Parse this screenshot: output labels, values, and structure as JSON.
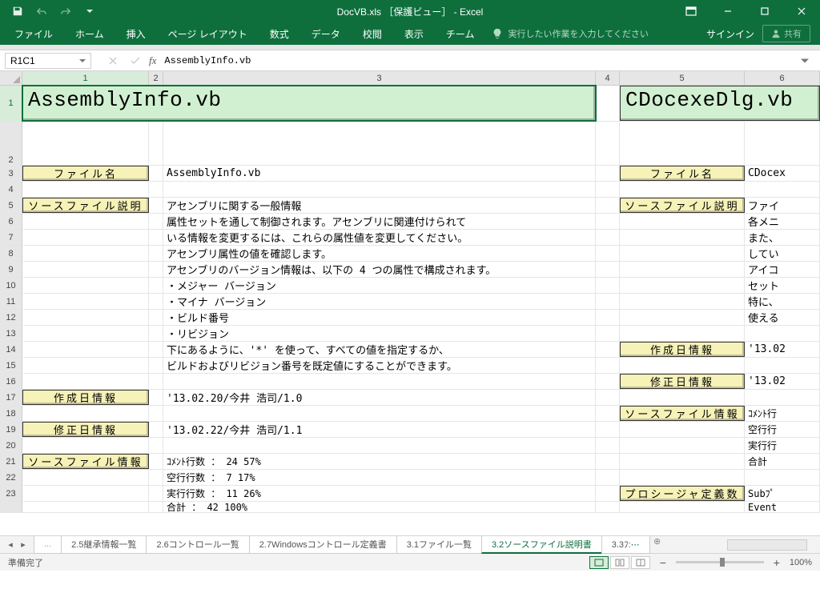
{
  "window": {
    "title": "DocVB.xls ［保護ビュー］ - Excel"
  },
  "ribbon": {
    "tabs": [
      "ファイル",
      "ホーム",
      "挿入",
      "ページ レイアウト",
      "数式",
      "データ",
      "校閲",
      "表示",
      "チーム"
    ],
    "tell_me": "実行したい作業を入力してください",
    "signin": "サインイン",
    "share": "共有"
  },
  "formula": {
    "name_box": "R1C1",
    "value": "AssemblyInfo.vb"
  },
  "columns": [
    "1",
    "2",
    "3",
    "4",
    "5",
    "6"
  ],
  "headers": {
    "left_title": "AssemblyInfo.vb",
    "right_title": "CDocexeDlg.vb"
  },
  "labels": {
    "file_name": "ファイル名",
    "source_desc": "ソースファイル説明",
    "create_info": "作成日情報",
    "update_info": "修正日情報",
    "source_info": "ソースファイル情報",
    "proc_def": "プロシージャ定義数"
  },
  "values": {
    "file_name_val": "AssemblyInfo.vb",
    "desc": [
      "アセンブリに関する一般情報",
      "属性セットを通して制御されます。アセンブリに関連付けられて",
      "いる情報を変更するには、これらの属性値を変更してください。",
      "アセンブリ属性の値を確認します。",
      "アセンブリのバージョン情報は、以下の 4 つの属性で構成されます。",
      "・メジャー バージョン",
      "・マイナ バージョン",
      "・ビルド番号",
      "・リビジョン",
      "下にあるように、'*' を使って、すべての値を指定するか、",
      "ビルドおよびリビジョン番号を既定値にすることができます。"
    ],
    "create_val": "'13.02.20/今井 浩司/1.0",
    "update_val": "'13.02.22/今井 浩司/1.1",
    "src_info": [
      "ｺﾒﾝﾄ行数 ：    24    57%",
      "空行行数 ：     7    17%",
      "実行行数 ：    11    26%",
      "合計     ：    42   100%"
    ],
    "right_col": {
      "file_name_val": "CDocex",
      "desc": [
        "ファイ",
        "各メニ",
        "また、",
        "してい",
        "アイコ",
        "セット",
        "特に、",
        "使える"
      ],
      "create_val": "'13.02",
      "update_val": "'13.02",
      "src_info": [
        "ｺﾒﾝﾄ行",
        "空行行",
        "実行行",
        "合計"
      ],
      "proc": [
        "Subﾌﾟ",
        "Event"
      ]
    }
  },
  "sheets": {
    "overflow": "...",
    "tabs": [
      "2.5継承情報一覧",
      "2.6コントロール一覧",
      "2.7Windowsコントロール定義書",
      "3.1ファイル一覧",
      "3.2ソースファイル説明書"
    ],
    "truncated": "3.3ﾌ: ",
    "active": "3.2ソースファイル説明書"
  },
  "status": {
    "ready": "準備完了",
    "zoom": "100%"
  }
}
